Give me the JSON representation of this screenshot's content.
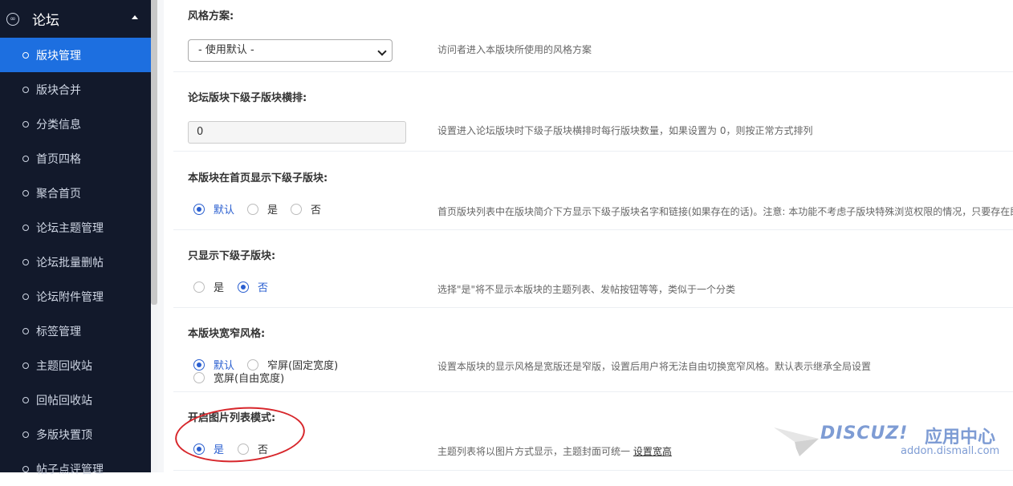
{
  "sidebar": {
    "section_title": "论坛",
    "items": [
      {
        "label": "版块管理",
        "active": true
      },
      {
        "label": "版块合并"
      },
      {
        "label": "分类信息"
      },
      {
        "label": "首页四格"
      },
      {
        "label": "聚合首页"
      },
      {
        "label": "论坛主题管理"
      },
      {
        "label": "论坛批量删帖"
      },
      {
        "label": "论坛附件管理"
      },
      {
        "label": "标签管理"
      },
      {
        "label": "主题回收站"
      },
      {
        "label": "回帖回收站"
      },
      {
        "label": "多版块置顶"
      },
      {
        "label": "帖子点评管理"
      }
    ]
  },
  "settings": {
    "style": {
      "title": "风格方案:",
      "selected": "- 使用默认 -",
      "desc": "访问者进入本版块所使用的风格方案"
    },
    "subforum_cols": {
      "title": "论坛版块下级子版块横排:",
      "value": "0",
      "desc": "设置进入论坛版块时下级子版块横排时每行版块数量，如果设置为 0，则按正常方式排列"
    },
    "show_sub_on_index": {
      "title": "本版块在首页显示下级子版块:",
      "options": [
        "默认",
        "是",
        "否"
      ],
      "desc": "首页版块列表中在版块简介下方显示下级子版块名字和链接(如果存在的话)。注意: 本功能不考虑子版块特殊浏览权限的情况，只要存在即"
    },
    "only_show_sub": {
      "title": "只显示下级子版块:",
      "options": [
        "是",
        "否"
      ],
      "desc": "选择\"是\"将不显示本版块的主题列表、发帖按钮等等，类似于一个分类"
    },
    "width_style": {
      "title": "本版块宽窄风格:",
      "options": [
        "默认",
        "窄屏(固定宽度)",
        "宽屏(自由宽度)"
      ],
      "desc": "设置本版块的显示风格是宽版还是窄版，设置后用户将无法自由切换宽窄风格。默认表示继承全局设置"
    },
    "picture_list": {
      "title": "开启图片列表模式:",
      "options": [
        "是",
        "否"
      ],
      "desc": "主题列表将以图片方式显示，主题封面可统一",
      "link": "设置宽高"
    }
  },
  "watermark": {
    "brand": "DISCUZ!",
    "cn": "应用中心",
    "url": "addon.dismall.com"
  }
}
